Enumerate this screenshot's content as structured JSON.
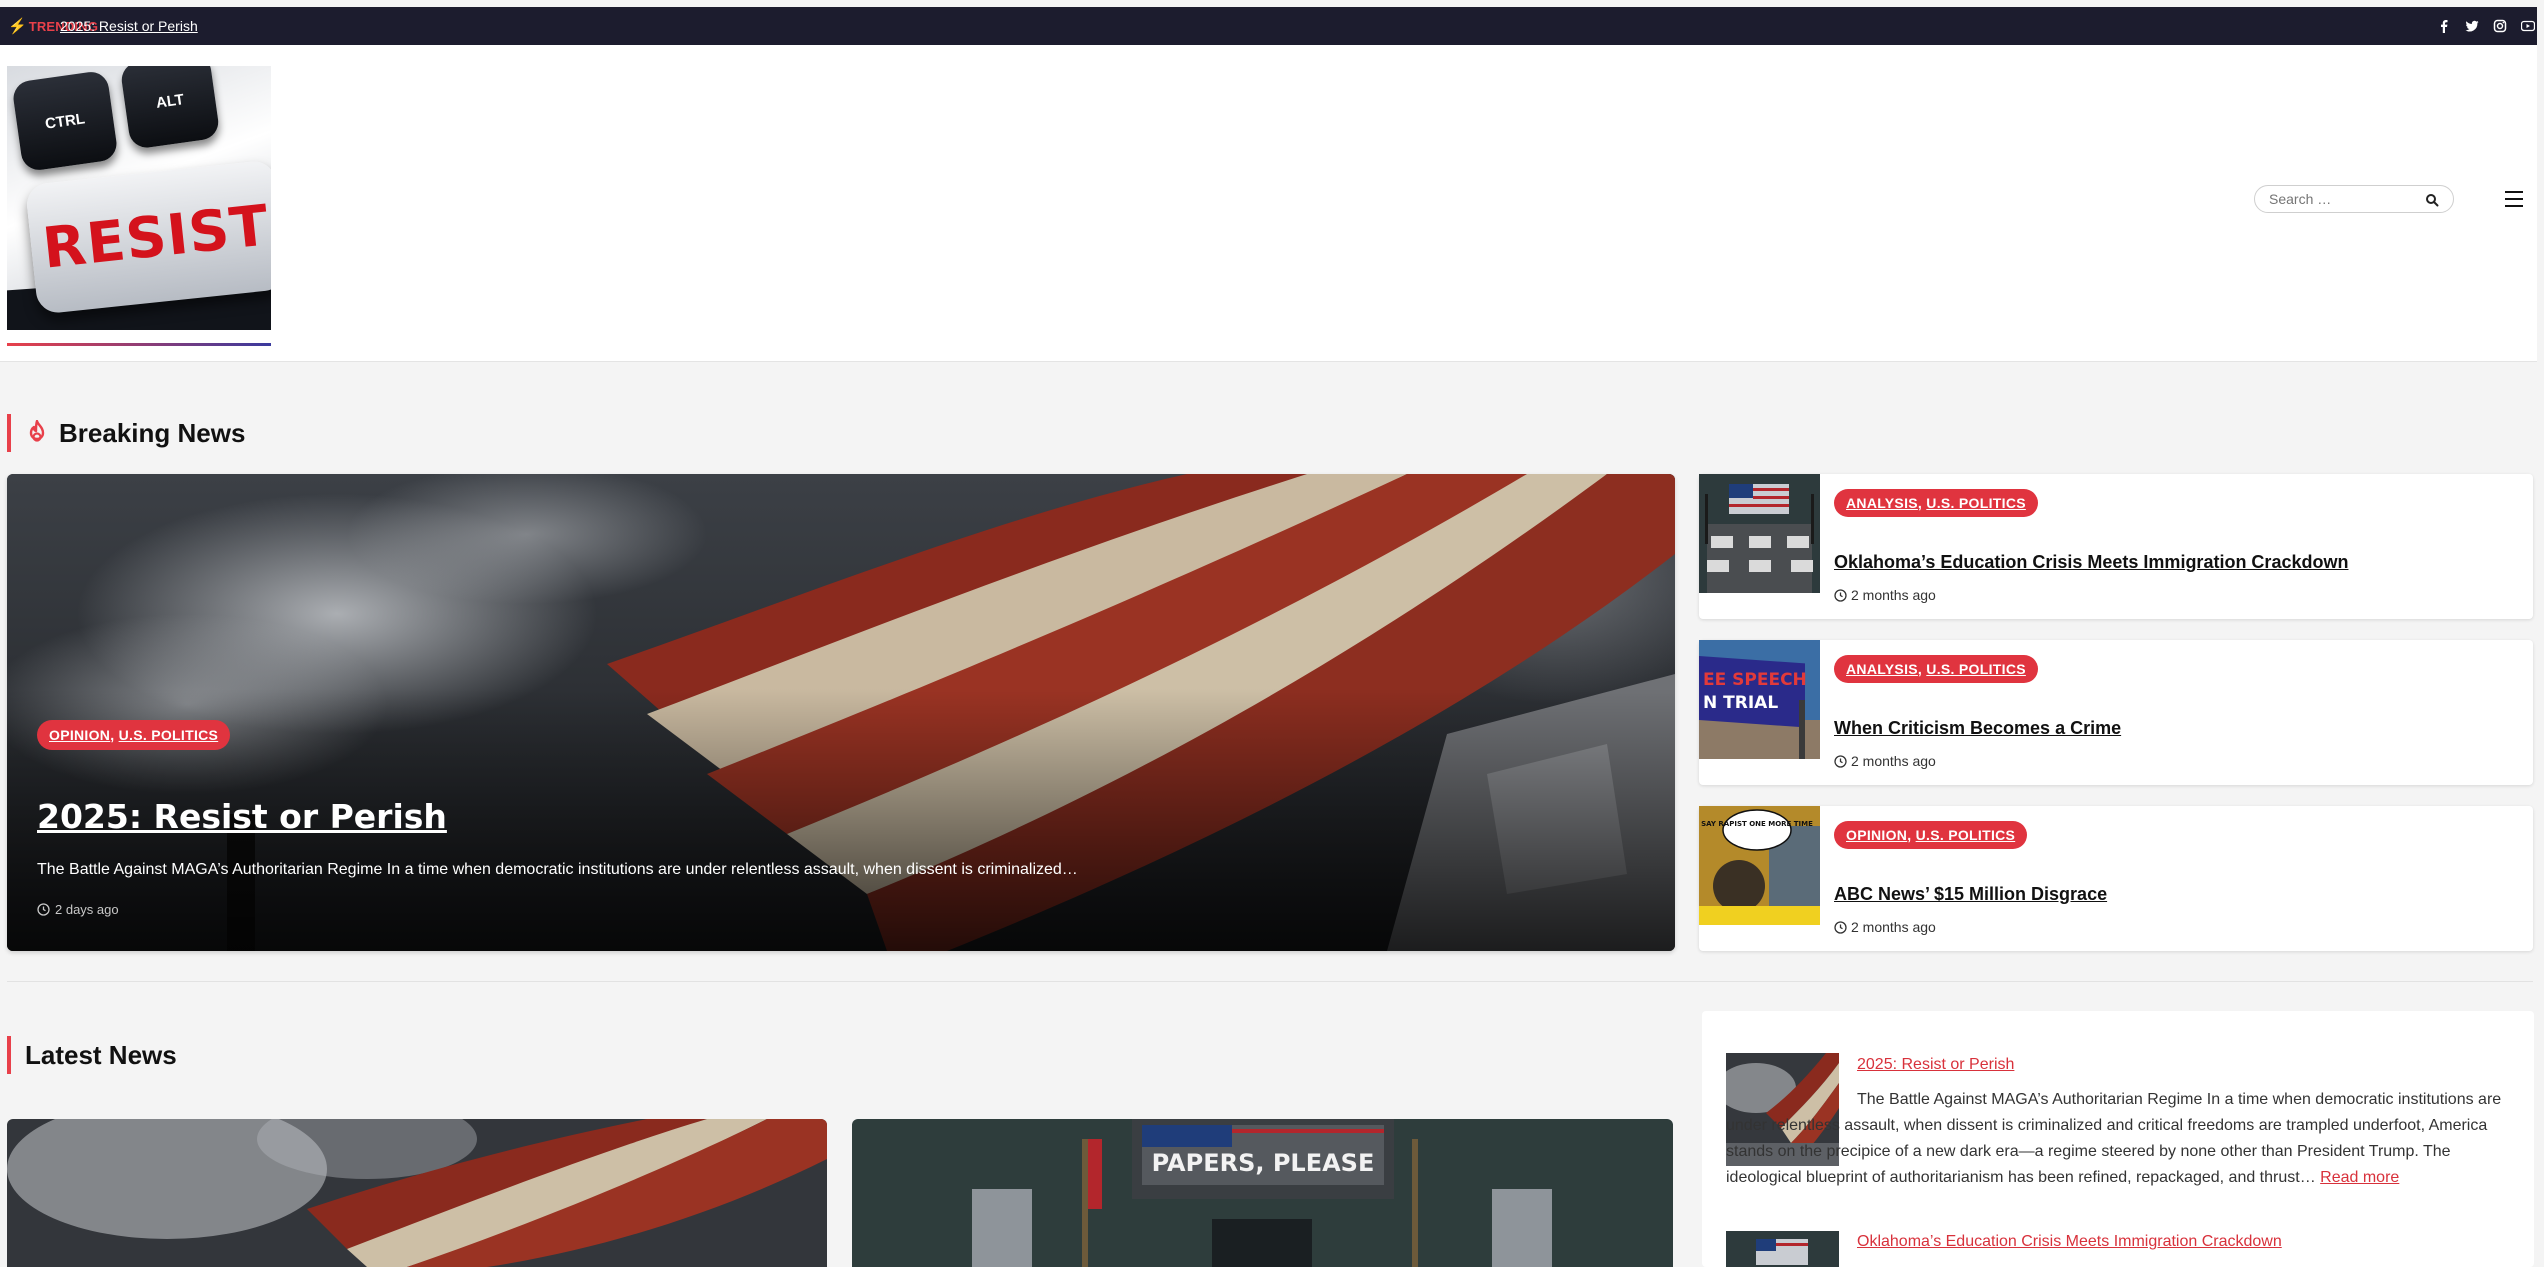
{
  "topbar": {
    "trending_label": "TRENDING",
    "ticker_text": "2025: Resist or Perish",
    "social_icons": [
      "facebook-icon",
      "twitter-icon",
      "instagram-icon",
      "youtube-icon"
    ]
  },
  "header": {
    "logo": {
      "key_ctrl": "CTRL",
      "key_alt": "ALT",
      "key_main": "RESIST"
    },
    "search_placeholder": "Search …"
  },
  "breaking": {
    "heading": "Breaking News",
    "hero": {
      "categories": [
        "OPINION",
        "U.S. POLITICS"
      ],
      "title": "2025: Resist or Perish",
      "excerpt": "The Battle Against MAGA’s Authoritarian Regime In a time when democratic institutions are under relentless assault, when dissent is criminalized…",
      "time": "2 days ago"
    },
    "side": [
      {
        "categories": [
          "ANALYSIS",
          "U.S. POLITICS"
        ],
        "title": "Oklahoma’s Education Crisis Meets Immigration Crackdown",
        "time": "2 months ago"
      },
      {
        "categories": [
          "ANALYSIS",
          "U.S. POLITICS"
        ],
        "title": "When Criticism Becomes a Crime",
        "time": "2 months ago",
        "thumb_text_1": "EE SPEECH",
        "thumb_text_2": "N TRIAL"
      },
      {
        "categories": [
          "OPINION",
          "U.S. POLITICS"
        ],
        "title": "ABC News’ $15 Million Disgrace",
        "time": "2 months ago",
        "thumb_text": "SAY RAPIST ONE MORE TIME"
      }
    ]
  },
  "latest": {
    "heading": "Latest News",
    "card2_sign": "PAPERS, PLEASE"
  },
  "widget": {
    "post1_title": "2025: Resist or Perish",
    "post1_excerpt": "The Battle Against MAGA’s Authoritarian Regime In a time when democratic institutions are under relentless assault, when dissent is criminalized and critical freedoms are trampled underfoot, America stands on the precipice of a new dark era—a regime steered by none other than President Trump. The ideological blueprint of authoritarianism has been refined, repackaged, and thrust…",
    "read_more": "Read more",
    "post2_title": "Oklahoma’s Education Crisis Meets Immigration Crackdown"
  },
  "colors": {
    "accent": "#e0343f",
    "topbar_bg": "#1c1c2e",
    "page_bg": "#f4f4f4"
  }
}
